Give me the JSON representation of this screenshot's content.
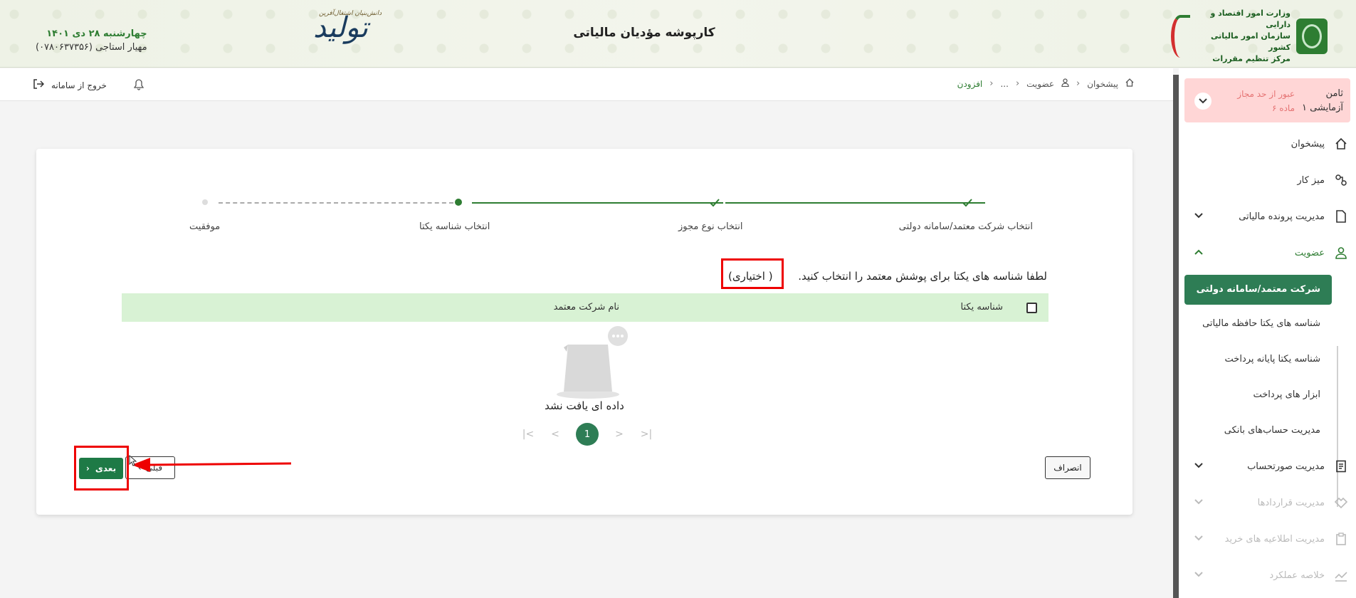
{
  "header": {
    "app_title": "کارپوشه مؤدیان مالیاتی",
    "date": "چهارشنبه ۲۸ دی ۱۴۰۱",
    "user": "مهیار استاجی (۰۷۸۰۶۳۷۳۵۶)",
    "logo_line1": "وزارت امور اقتصاد و دارایی",
    "logo_line2": "سازمان امور مالیاتی کشور",
    "logo_line3": "مرکز تنظیم مقررات",
    "slogan": "تولید",
    "slogan_small": "دانش‌بنیان اشتغال‌آفرین"
  },
  "toolbar": {
    "logout_label": "خروج از سامانه",
    "breadcrumb": [
      "پیشخوان",
      "عضویت",
      "...",
      "افزودن"
    ]
  },
  "sidebar": {
    "user_name_line1": "ثامن",
    "user_name_line2": "آزمایشی ۱",
    "warn_line1": "عبور از حد مجاز",
    "warn_line2": "ماده ۶",
    "items": [
      {
        "label": "پیشخوان"
      },
      {
        "label": "میز کار"
      },
      {
        "label": "مدیریت پرونده مالیاتی"
      },
      {
        "label": "عضویت"
      },
      {
        "label": "مدیریت صورتحساب"
      },
      {
        "label": "مدیریت قراردادها"
      },
      {
        "label": "مدیریت اطلاعیه های خرید"
      },
      {
        "label": "خلاصه عملکرد"
      }
    ],
    "sub_items": [
      {
        "label": "شرکت معتمد/سامانه دولتی"
      },
      {
        "label": "شناسه های یکتا حافظه مالیاتی"
      },
      {
        "label": "شناسه یکتا پایانه پرداخت"
      },
      {
        "label": "ابزار های پرداخت"
      },
      {
        "label": "مدیریت حساب‌های بانکی"
      }
    ]
  },
  "steps": [
    {
      "label": "انتخاب شرکت معتمد/سامانه دولتی",
      "state": "done"
    },
    {
      "label": "انتخاب نوع مجوز",
      "state": "done"
    },
    {
      "label": "انتخاب شناسه یکتا",
      "state": "current"
    },
    {
      "label": "موفقیت",
      "state": "pending"
    }
  ],
  "form": {
    "prompt": "لطفا شناسه های یکتا برای پوشش معتمد را انتخاب کنید.",
    "optional": "(اختیاری )",
    "col_id": "شناسه یکتا",
    "col_company": "نام شرکت معتمد",
    "empty": "داده ای یافت نشد",
    "page": "1",
    "cancel_label": "انصراف",
    "prev_label": "قبلی",
    "next_label": "بعدی"
  },
  "colors": {
    "primary": "#2e7d55",
    "highlight": "#e00000",
    "table_header": "#d8f2d4",
    "warn_bg": "#ffd6d6"
  }
}
